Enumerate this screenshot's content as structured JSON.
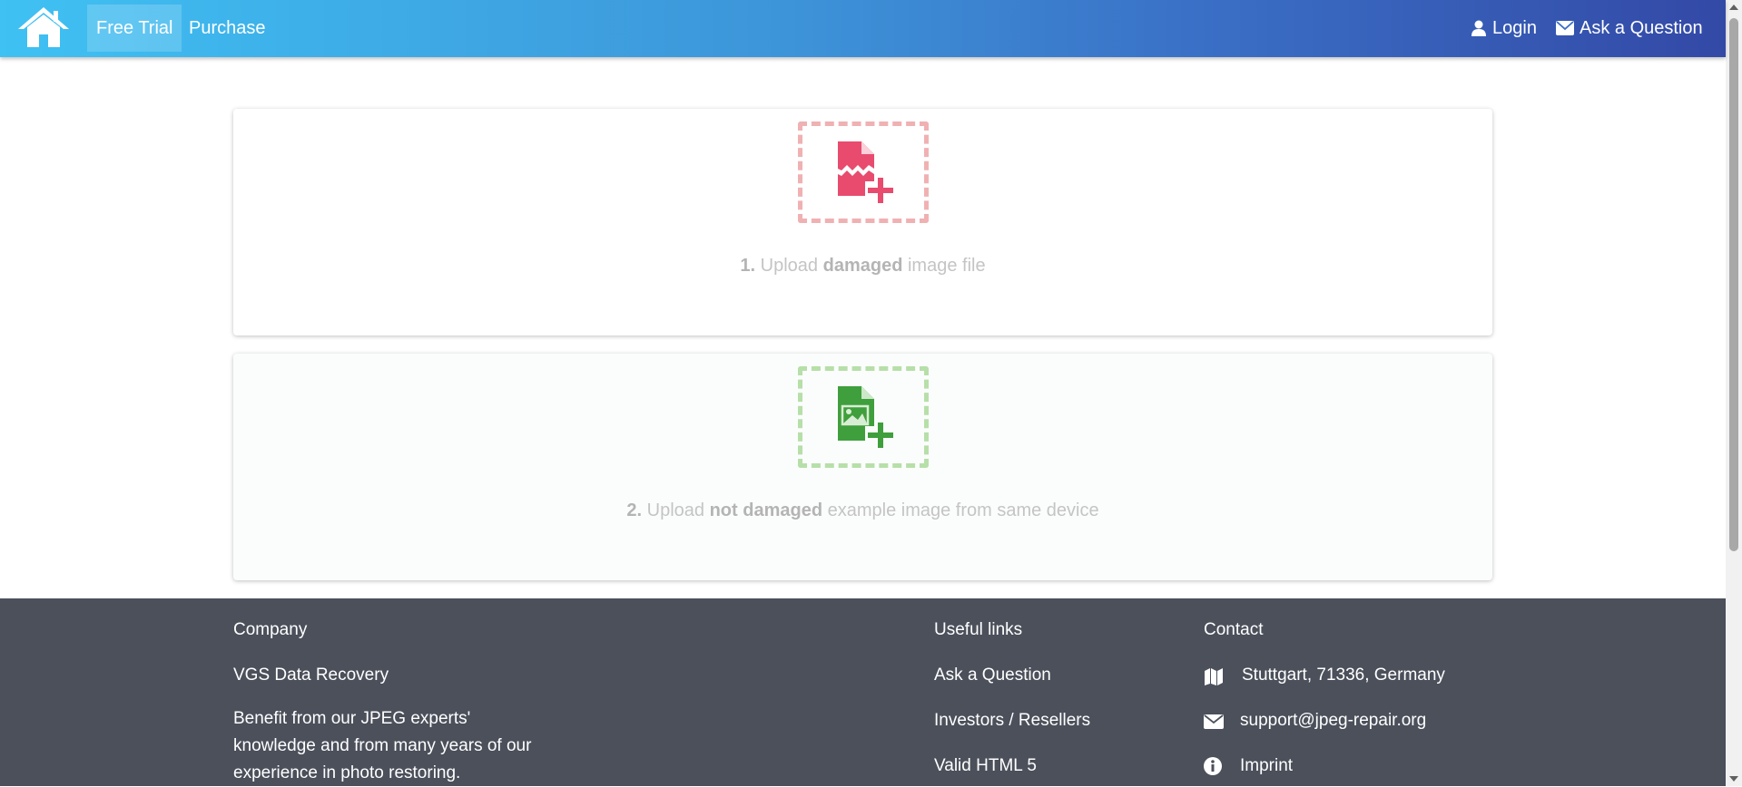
{
  "nav": {
    "home_icon": "home-icon",
    "free_trial": "Free Trial",
    "purchase": "Purchase",
    "login": "Login",
    "ask": "Ask a Question"
  },
  "upload": {
    "damaged": {
      "num": "1.",
      "pre": "Upload",
      "bold": "damaged",
      "post": "image file",
      "icon": "broken-file-add-icon",
      "color": "#e84b6e"
    },
    "example": {
      "num": "2.",
      "pre": "Upload",
      "bold": "not damaged",
      "post": "example image from same device",
      "icon": "image-file-add-icon",
      "color": "#3f9f3c"
    }
  },
  "footer": {
    "company": {
      "heading": "Company",
      "name": "VGS Data Recovery",
      "text": "Benefit from our JPEG experts' knowledge and from many years of our experience in photo restoring."
    },
    "links": {
      "heading": "Useful links",
      "items": [
        "Ask a Question",
        "Investors / Resellers",
        "Valid HTML 5"
      ]
    },
    "contact": {
      "heading": "Contact",
      "address": "Stuttgart, 71336, Germany",
      "email": "support@jpeg-repair.org",
      "imprint": "Imprint"
    }
  }
}
